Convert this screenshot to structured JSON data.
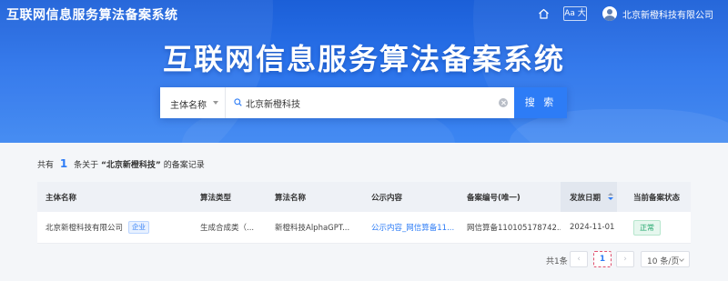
{
  "header": {
    "app_title": "互联网信息服务算法备案系统",
    "font_size_toggle": "Aa 大",
    "user_name": "北京新橙科技有限公司"
  },
  "hero": {
    "title": "互联网信息服务算法备案系统"
  },
  "search": {
    "type_label": "主体名称",
    "query": "北京新橙科技",
    "button_label": "搜 索"
  },
  "summary": {
    "prefix": "共有",
    "count": "1",
    "middle": "条关于",
    "keyword": "“北京新橙科技”",
    "suffix": "的备案记录"
  },
  "table": {
    "columns": [
      "主体名称",
      "算法类型",
      "算法名称",
      "公示内容",
      "备案编号(唯一)",
      "发放日期",
      "当前备案状态"
    ],
    "rows": [
      {
        "entity": "北京新橙科技有限公司",
        "entity_tag": "企业",
        "algo_type": "生成合成类（...",
        "algo_name": "新橙科技AlphaGPT...",
        "public_content": "公示内容_网信算备11...",
        "filing_no": "网信算备110105178742...",
        "issue_date": "2024-11-01",
        "status": "正常"
      }
    ]
  },
  "pagination": {
    "total": "共1条",
    "prev": "‹",
    "current_page": "1",
    "next": "›",
    "page_size": "10 条/页"
  },
  "colors": {
    "brand_blue": "#2d7cf6",
    "hero_blue": "#1b5fd8",
    "status_green": "#1fa56a"
  }
}
